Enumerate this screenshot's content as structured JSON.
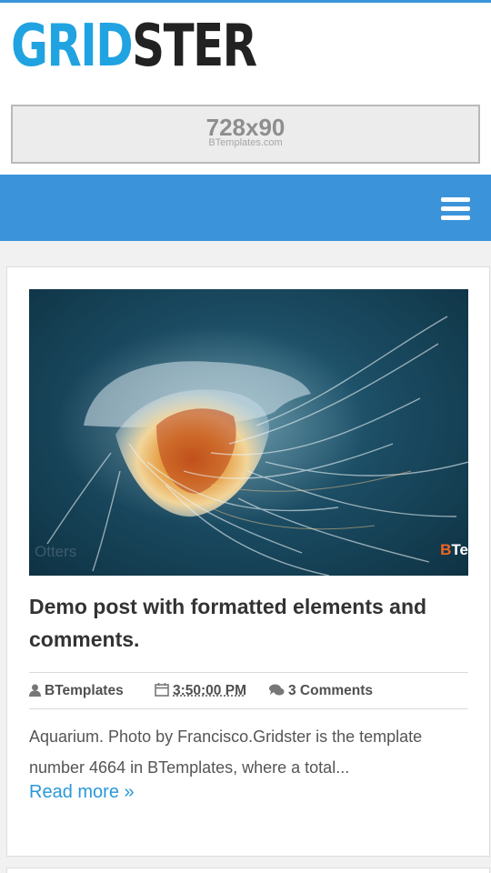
{
  "logo": {
    "part1": "GRID",
    "part2": "STER"
  },
  "ad": {
    "size": "728x90",
    "brand": "BTemplates.com"
  },
  "nav": {
    "menu_icon": "hamburger-menu-icon"
  },
  "post": {
    "image": {
      "watermark_left": "Otters",
      "watermark_right_b": "B",
      "watermark_right_rest": "Te"
    },
    "title": "Demo post with formatted elements and comments.",
    "meta": {
      "author": "BTemplates",
      "time": "3:50:00 PM",
      "comments": "3 Comments",
      "author_icon": "user-icon",
      "time_icon": "calendar-icon",
      "comments_icon": "comments-icon"
    },
    "excerpt": "Aquarium. Photo by Francisco.Gridster is the template number 4664 in BTemplates, where a total...",
    "read_more": "Read more »"
  },
  "colors": {
    "accent": "#3b94d9",
    "logo_blue": "#20a3e0",
    "link": "#2a98d8"
  }
}
